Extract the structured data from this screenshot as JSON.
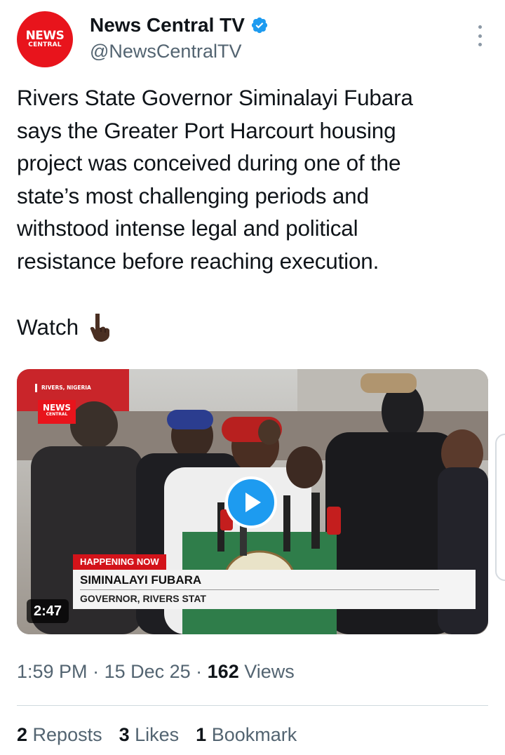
{
  "account": {
    "display_name": "News Central TV",
    "handle": "@NewsCentralTV",
    "avatar_text_top": "NEWS",
    "avatar_text_bottom": "CENTRAL",
    "verified_icon": "verified-badge-icon",
    "more_icon": "more-vertical-icon"
  },
  "tweet": {
    "text": "Rivers State Governor Siminalayi Fubara\nsays the Greater Port Harcourt housing\nproject was conceived during one of the\nstate’s most challenging periods and\nwithstood intense legal and political\nresistance before reaching execution.",
    "watch_label": "Watch",
    "watch_emoji_icon": "pointing-down-hand-icon"
  },
  "video": {
    "location_tag": "RIVERS, NIGERIA",
    "logo_top": "NEWS",
    "logo_bottom": "CENTRAL",
    "lower_third_tag": "HAPPENING NOW",
    "lower_third_name": "SIMINALAYI FUBARA",
    "lower_third_title": "GOVERNOR, RIVERS STAT",
    "duration": "2:47",
    "play_icon": "play-icon"
  },
  "meta": {
    "time": "1:59 PM",
    "sep1": " · ",
    "date": "15 Dec 25",
    "sep2": " · ",
    "views_count": "162",
    "views_label": " Views"
  },
  "stats": {
    "reposts_count": "2",
    "reposts_label": " Reposts",
    "likes_count": "3",
    "likes_label": " Likes",
    "bookmarks_count": "1",
    "bookmarks_label": " Bookmark"
  },
  "colors": {
    "brand_red": "#e8141c",
    "accent_blue": "#1d9bf0",
    "text_primary": "#0f1419",
    "text_secondary": "#536471"
  }
}
